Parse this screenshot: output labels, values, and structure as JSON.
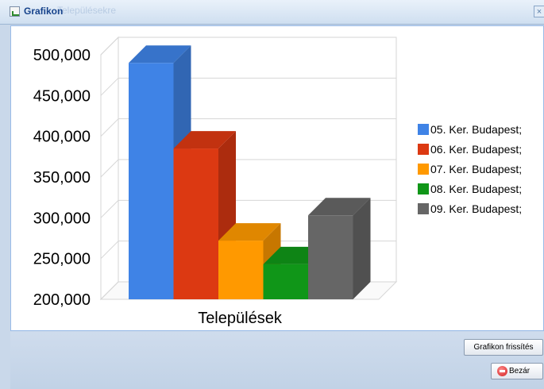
{
  "window": {
    "title": "Grafikon",
    "background_title": "Településekre",
    "close_glyph": "×"
  },
  "buttons": {
    "refresh_label": "Grafikon frissítés",
    "close_label": "Bezár"
  },
  "icons": {
    "title": "chart-window-icon",
    "close": "close-icon",
    "bezar": "red-circle-close-icon"
  },
  "chart_data": {
    "type": "bar",
    "title": "",
    "xlabel": "Települések",
    "ylabel": "",
    "categories": [
      "Települések"
    ],
    "ylim": [
      200000,
      500000
    ],
    "yticks": [
      "500,000",
      "450,000",
      "400,000",
      "350,000",
      "300,000",
      "250,000",
      "200,000"
    ],
    "ytick_values": [
      500000,
      450000,
      400000,
      350000,
      300000,
      250000,
      200000
    ],
    "legend_position": "right",
    "grid": true,
    "three_d": true,
    "series": [
      {
        "name": "05. Ker. Budapest;",
        "values": [
          490000
        ],
        "color": "#3f83e6"
      },
      {
        "name": "06. Ker. Budapest;",
        "values": [
          385000
        ],
        "color": "#dc3912"
      },
      {
        "name": "07. Ker. Budapest;",
        "values": [
          272000
        ],
        "color": "#ff9900"
      },
      {
        "name": "08. Ker. Budapest;",
        "values": [
          243000
        ],
        "color": "#109618"
      },
      {
        "name": "09. Ker. Budapest;",
        "values": [
          303000
        ],
        "color": "#666666"
      }
    ]
  }
}
